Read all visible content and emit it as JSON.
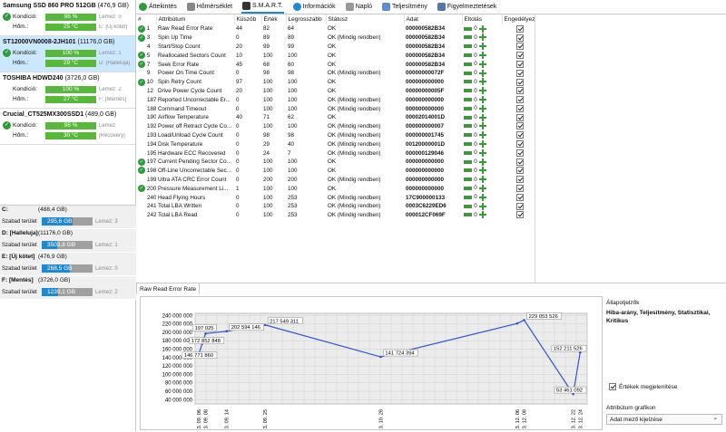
{
  "drives": [
    {
      "name": "Samsung SSD 860 PRO 512GB",
      "cap": "(476,9 GB)",
      "health_label": "Kondíció:",
      "health": "96 %",
      "temp_label": "Hőm.:",
      "temp": "25 °C",
      "note1": "Lemez: 0",
      "note2": "E: [Új kötet]",
      "selected": false,
      "ok": true
    },
    {
      "name": "ST12000VN0008-2JH101",
      "cap": "(11176,0 GB)",
      "health_label": "Kondíció:",
      "health": "100 %",
      "temp_label": "Hőm.:",
      "temp": "29 °C",
      "note1": "Lemez: 1",
      "note2": "D: [Halleluja]",
      "selected": true,
      "ok": true
    },
    {
      "name": "TOSHIBA HDWD240",
      "cap": "(3726,0 GB)",
      "health_label": "Kondíció:",
      "health": "100 %",
      "temp_label": "Hőm.:",
      "temp": "27 °C",
      "note1": "Lemez: 2",
      "note2": "F: [Mentés]",
      "selected": false,
      "ok": false
    },
    {
      "name": "Crucial_CT525MX300SSD1",
      "cap": "(489,0 GB)",
      "health_label": "Kondíció:",
      "health": "96 %",
      "temp_label": "Hőm.:",
      "temp": "30 °C",
      "note1": "Lemez",
      "note2": "[Recovery]",
      "selected": false,
      "ok": true
    }
  ],
  "partitions": [
    {
      "name": "C:",
      "size": "(488,4 GB)",
      "free_label": "Szabad terület",
      "free": "295,6 GB",
      "fill": 0.6,
      "note": "Lemez: 3"
    },
    {
      "name": "D: [Halleluja]",
      "size": "(11176,0 GB)",
      "free_label": "Szabad terület",
      "free": "3503,8 GB",
      "fill": 0.31,
      "note": "Lemez: 1"
    },
    {
      "name": "E: [Új kötet]",
      "size": "(476,9 GB)",
      "free_label": "Szabad terület",
      "free": "268,5 GB",
      "fill": 0.56,
      "note": "Lemez: 0"
    },
    {
      "name": "F: [Mentés]",
      "size": "(3726,0 GB)",
      "free_label": "Szabad terület",
      "free": "1239,1 GB",
      "fill": 0.33,
      "note": "Lemez: 2"
    }
  ],
  "tabs": [
    {
      "label": "Áttekintés",
      "icon": "check-icon",
      "color": "#2e9c3a"
    },
    {
      "label": "Hőmérséklet",
      "icon": "thermometer-icon",
      "color": "#888888"
    },
    {
      "label": "S.M.A.R.T.",
      "icon": "smart-icon",
      "color": "#333333",
      "active": true
    },
    {
      "label": "Információk",
      "icon": "info-icon",
      "color": "#1e88d0"
    },
    {
      "label": "Napló",
      "icon": "log-icon",
      "color": "#999999"
    },
    {
      "label": "Teljesítmény",
      "icon": "performance-icon",
      "color": "#5a8fd0"
    },
    {
      "label": "Figyelmeztetések",
      "icon": "warning-icon",
      "color": "#5577aa"
    }
  ],
  "table": {
    "headers": [
      "#",
      "Attribútum",
      "Küszöb",
      "Érték",
      "Legrosszabb",
      "Státusz",
      "Adat",
      "Eltolás",
      "Engedélyez"
    ],
    "rows": [
      {
        "check": true,
        "id": "1",
        "attr": "Raw Read Error Rate",
        "thr": "44",
        "val": "82",
        "worst": "64",
        "status": "OK",
        "data": "000000129046",
        "off": "0"
      },
      {
        "check": true,
        "id": "3",
        "attr": "Spin Up Time",
        "thr": "0",
        "val": "89",
        "worst": "89",
        "status": "OK (Mindig rendben)",
        "data": "000000000000",
        "off": "0"
      },
      {
        "check": false,
        "id": "4",
        "attr": "Start/Stop Count",
        "thr": "20",
        "val": "99",
        "worst": "99",
        "status": "OK",
        "data": "00000000042E",
        "off": "0"
      },
      {
        "check": true,
        "id": "5",
        "attr": "Reallocated Sectors Count",
        "thr": "10",
        "val": "100",
        "worst": "100",
        "status": "OK",
        "data": "000000000000",
        "off": "0"
      },
      {
        "check": true,
        "id": "7",
        "attr": "Seek Error Rate",
        "thr": "45",
        "val": "68",
        "worst": "60",
        "status": "OK",
        "data": 0,
        "data_text": "000000582B34",
        "off": "0"
      },
      {
        "check": false,
        "id": "9",
        "attr": "Power On Time Count",
        "thr": "0",
        "val": "98",
        "worst": "98",
        "status": "OK (Mindig rendben)",
        "data_text": "00000000072F",
        "off": "0"
      },
      {
        "check": true,
        "id": "10",
        "attr": "Spin Retry Count",
        "thr": "97",
        "val": "100",
        "worst": "100",
        "status": "OK",
        "data_text": "000000000000",
        "off": "0"
      },
      {
        "check": false,
        "id": "12",
        "attr": "Drive Power Cycle Count",
        "thr": "20",
        "val": "100",
        "worst": "100",
        "status": "OK",
        "data_text": "00000000005F",
        "off": "0"
      },
      {
        "check": false,
        "id": "187",
        "attr": "Reported Uncorrectable Er...",
        "thr": "0",
        "val": "100",
        "worst": "100",
        "status": "OK (Mindig rendben)",
        "data_text": "000000000000",
        "off": "0"
      },
      {
        "check": false,
        "id": "188",
        "attr": "Command Timeout",
        "thr": "0",
        "val": "100",
        "worst": "100",
        "status": "OK (Mindig rendben)",
        "data_text": "000000000000",
        "off": "0"
      },
      {
        "check": false,
        "id": "190",
        "attr": "Airflow Temperature",
        "thr": "40",
        "val": "71",
        "worst": "62",
        "status": "OK",
        "data_text": "00002014001D",
        "off": "0"
      },
      {
        "check": false,
        "id": "192",
        "attr": "Power off Retract Cycle Co...",
        "thr": "0",
        "val": "100",
        "worst": "100",
        "status": "OK (Mindig rendben)",
        "data_text": "000000000007",
        "off": "0"
      },
      {
        "check": false,
        "id": "193",
        "attr": "Load/Unload Cycle Count",
        "thr": "0",
        "val": "98",
        "worst": "98",
        "status": "OK (Mindig rendben)",
        "data_text": "000000001745",
        "off": "0"
      },
      {
        "check": false,
        "id": "194",
        "attr": "Disk Temperature",
        "thr": "0",
        "val": "29",
        "worst": "40",
        "status": "OK (Mindig rendben)",
        "data_text": "00120000001D",
        "off": "0"
      },
      {
        "check": false,
        "id": "195",
        "attr": "Hardware ECC Recovered",
        "thr": "0",
        "val": "24",
        "worst": "7",
        "status": "OK (Mindig rendben)",
        "data_text": "000000129046",
        "off": "0"
      },
      {
        "check": true,
        "id": "197",
        "attr": "Current Pending Sector Co...",
        "thr": "0",
        "val": "100",
        "worst": "100",
        "status": "OK",
        "data_text": "000000000000",
        "off": "0"
      },
      {
        "check": true,
        "id": "198",
        "attr": "Off-Line Uncorrectable Sec...",
        "thr": "0",
        "val": "100",
        "worst": "100",
        "status": "OK",
        "data_text": "000000000000",
        "off": "0"
      },
      {
        "check": false,
        "id": "199",
        "attr": "Ultra ATA CRC Error Count",
        "thr": "0",
        "val": "200",
        "worst": "200",
        "status": "OK (Mindig rendben)",
        "data_text": "000000000000",
        "off": "0"
      },
      {
        "check": true,
        "id": "200",
        "attr": "Pressure Measurement Li...",
        "thr": "1",
        "val": "100",
        "worst": "100",
        "status": "OK",
        "data_text": "000000000000",
        "off": "0"
      },
      {
        "check": false,
        "id": "240",
        "attr": "Head Flying Hours",
        "thr": "0",
        "val": "100",
        "worst": "253",
        "status": "OK (Mindig rendben)",
        "data_text": "17C900000133",
        "off": "0"
      },
      {
        "check": false,
        "id": "241",
        "attr": "Total LBA Written",
        "thr": "0",
        "val": "100",
        "worst": "253",
        "status": "OK (Mindig rendben)",
        "data_text": "0003C6229ED6",
        "off": "0"
      },
      {
        "check": false,
        "id": "242",
        "attr": "Total LBA Read",
        "thr": "0",
        "val": "100",
        "worst": "253",
        "status": "OK (Mindig rendben)",
        "data_text": "000012CF069F",
        "off": "0"
      }
    ]
  },
  "bottom": {
    "tab_label": "Raw Read Error Rate",
    "side_title": "Állapotjelzők",
    "side_values": "Hiba-arány, Teljesítmény, Statisztikai, Kritikus",
    "show_values_label": "Értékek megjelenítése",
    "attr_chart_label": "Attribútum grafikon",
    "select_value": "Adat mező kijelzése"
  },
  "chart_data": {
    "type": "line",
    "title": "",
    "xlabel": "",
    "ylabel": "",
    "yticks": [
      "240 000 000",
      "220 000 000",
      "200 000 000",
      "180 000 000",
      "160 000 000",
      "140 000 000",
      "120 000 000",
      "100 000 000",
      "80 000 000",
      "60 000 000",
      "40 000 000"
    ],
    "ylim": [
      30000000,
      245000000
    ],
    "xticks": [
      "2023. 09. 06",
      "2023. 09. 08",
      "2023. 09. 14",
      "2023. 09. 25",
      "2023. 10. 28",
      "2023. 12. 06",
      "2023. 12. 08",
      "2023. 12. 22",
      "2023. 12. 24"
    ],
    "xlim": [
      "2023-09-05",
      "2023-12-26"
    ],
    "series": [
      {
        "color": "#3355cc",
        "points": [
          {
            "x": "2023-09-06",
            "y": 146771860,
            "label": "146 771 860"
          },
          {
            "x": "2023-09-07",
            "y": 172852848,
            "label": "172 852 848"
          },
          {
            "x": "2023-09-08",
            "y": 197025000,
            "label": "197 025"
          },
          {
            "x": "2023-09-14",
            "y": 202594146,
            "label": "202 594 146"
          },
          {
            "x": "2023-09-25",
            "y": 217549311,
            "label": "217 549 311"
          },
          {
            "x": "2023-10-28",
            "y": 141724394,
            "label": "141 724 394"
          },
          {
            "x": "2023-12-06",
            "y": 221000000,
            "label": ""
          },
          {
            "x": "2023-12-08",
            "y": 229053526,
            "label": "229 053 526"
          },
          {
            "x": "2023-12-22",
            "y": 53461092,
            "label": "53 461 092"
          },
          {
            "x": "2023-12-24",
            "y": 152211526,
            "label": "152 211 526"
          }
        ]
      }
    ],
    "grid": true
  }
}
